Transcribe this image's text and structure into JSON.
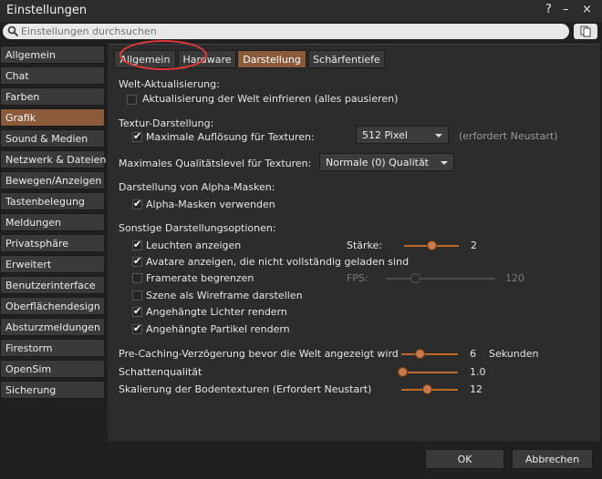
{
  "window": {
    "title": "Einstellungen",
    "help_label": "?",
    "minimize_label": "–",
    "close_label": "×"
  },
  "search": {
    "placeholder": "Einstellungen durchsuchen",
    "value": ""
  },
  "sidebar": {
    "items": [
      {
        "label": "Allgemein"
      },
      {
        "label": "Chat"
      },
      {
        "label": "Farben"
      },
      {
        "label": "Grafik"
      },
      {
        "label": "Sound & Medien"
      },
      {
        "label": "Netzwerk & Dateien"
      },
      {
        "label": "Bewegen/Anzeigen"
      },
      {
        "label": "Tastenbelegung"
      },
      {
        "label": "Meldungen"
      },
      {
        "label": "Privatsphäre"
      },
      {
        "label": "Erweitert"
      },
      {
        "label": "Benutzerinterface"
      },
      {
        "label": "Oberflächendesign"
      },
      {
        "label": "Absturzmeldungen"
      },
      {
        "label": "Firestorm"
      },
      {
        "label": "OpenSim"
      },
      {
        "label": "Sicherung"
      }
    ],
    "active_index": 3
  },
  "tabs": [
    {
      "label": "Allgemein"
    },
    {
      "label": "Hardware"
    },
    {
      "label": "Darstellung"
    },
    {
      "label": "Schärfentiefe"
    }
  ],
  "content": {
    "world_update": {
      "heading": "Welt-Aktualisierung:",
      "freeze_label": "Aktualisierung der Welt einfrieren (alles pausieren)",
      "freeze_checked": false
    },
    "texture": {
      "heading": "Textur-Darstellung:",
      "max_res_label": "Maximale Auflösung für Texturen:",
      "max_res_checked": true,
      "max_res_value": "512 Pixel",
      "restart_note": "(erfordert Neustart)"
    },
    "quality": {
      "label": "Maximales Qualitätslevel für Texturen:",
      "value": "Normale (0) Qualität"
    },
    "alpha": {
      "heading": "Darstellung von Alpha-Masken:",
      "use_label": "Alpha-Masken verwenden",
      "use_checked": true
    },
    "misc": {
      "heading": "Sonstige Darstellungsoptionen:",
      "glow_label": "Leuchten anzeigen",
      "glow_checked": true,
      "strength_label": "Stärke:",
      "strength_value": "2",
      "strength_fraction": 0.5,
      "avatars_label": "Avatare anzeigen, die nicht vollständig geladen sind",
      "avatars_checked": true,
      "fps_limit_label": "Framerate begrenzen",
      "fps_limit_checked": false,
      "fps_label": "FPS:",
      "fps_value": "120",
      "fps_fraction": 0.25,
      "wireframe_label": "Szene als Wireframe darstellen",
      "wireframe_checked": false,
      "lights_label": "Angehängte Lichter rendern",
      "lights_checked": true,
      "particles_label": "Angehängte Partikel rendern",
      "particles_checked": true
    },
    "precache": {
      "label": "Pre-Caching-Verzögerung bevor die Welt angezeigt wird",
      "value": "6",
      "unit": "Sekunden",
      "fraction": 0.3
    },
    "shadow": {
      "label": "Schattenqualität",
      "value": "1.0",
      "fraction": 0.0
    },
    "terrain": {
      "label": "Skalierung der Bodentexturen (Erfordert Neustart)",
      "value": "12",
      "fraction": 0.45
    }
  },
  "footer": {
    "ok_label": "OK",
    "cancel_label": "Abbrechen"
  },
  "colors": {
    "accent": "#8a5a3a",
    "highlight": "#e23a3a",
    "slider": "#c06a2a"
  }
}
